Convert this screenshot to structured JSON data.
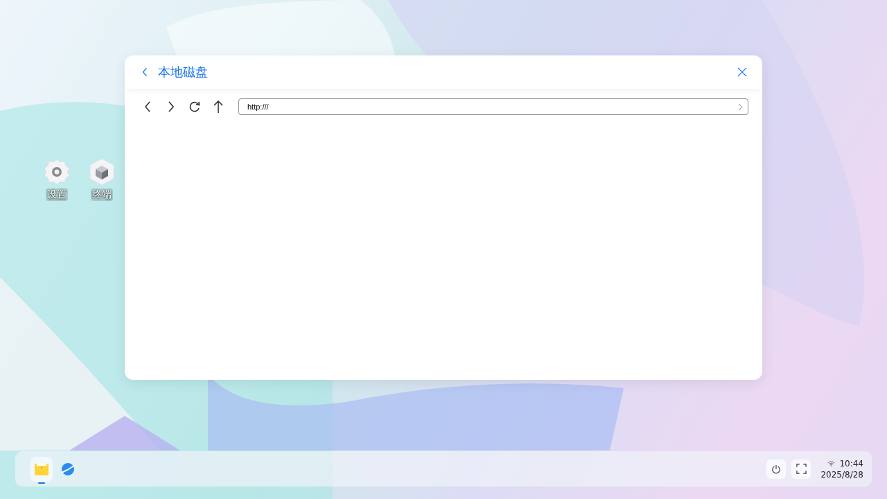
{
  "desktop_icons": [
    {
      "kind": "gear",
      "label": "设置"
    },
    {
      "kind": "cube",
      "label": "终端"
    }
  ],
  "window": {
    "title": "本地磁盘",
    "address": {
      "value": "http:///"
    }
  },
  "taskbar": {
    "apps": [
      {
        "kind": "folder",
        "selected": true
      },
      {
        "kind": "globe",
        "selected": false
      }
    ],
    "clock": {
      "time": "10:44",
      "date": "2025/8/28"
    }
  }
}
